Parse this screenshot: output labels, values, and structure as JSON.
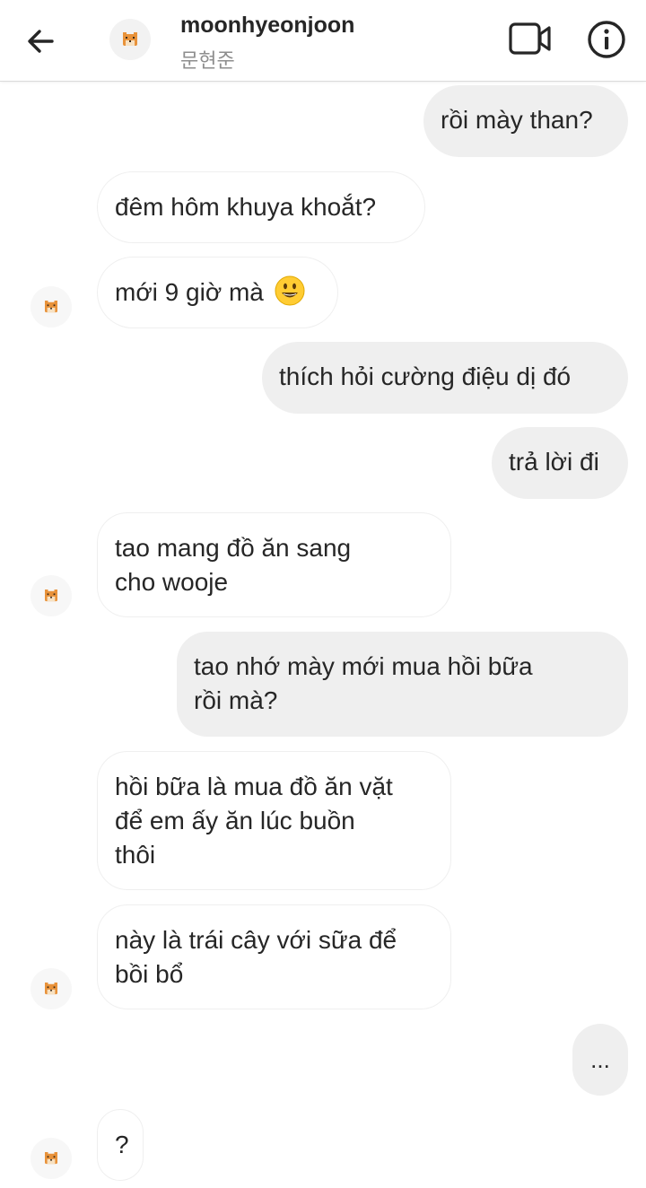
{
  "header": {
    "username": "moonhyeonjoon",
    "subname": "문현준",
    "back_icon": "arrow-left-icon",
    "video_icon": "video-camera-icon",
    "info_icon": "info-icon",
    "avatar_icon": "tiger-avatar-icon"
  },
  "messages": [
    {
      "from": "me",
      "text": "rồi mày than?"
    },
    {
      "from": "them",
      "text": "đêm hôm khuya khoắt?"
    },
    {
      "from": "them",
      "text": "mới 9 giờ mà",
      "emoji": "grinning-face-icon"
    },
    {
      "from": "me",
      "text": "thích hỏi cường điệu dị đó"
    },
    {
      "from": "me",
      "text": "trả lời đi"
    },
    {
      "from": "them",
      "lines": [
        "tao mang đồ ăn sang",
        "cho wooje"
      ]
    },
    {
      "from": "me",
      "lines": [
        "tao nhớ mày mới mua hồi bữa",
        "rồi mà?"
      ]
    },
    {
      "from": "them",
      "lines": [
        "hồi bữa là mua đồ ăn vặt",
        "để em ấy ăn lúc buồn",
        "thôi"
      ]
    },
    {
      "from": "them",
      "lines": [
        "này là trái cây với sữa để",
        "bồi bổ"
      ]
    },
    {
      "from": "me",
      "text": "..."
    },
    {
      "from": "them",
      "text": "?"
    }
  ],
  "colors": {
    "bubble_out": "#efefef",
    "bubble_in_border": "#efefef",
    "text": "#262626",
    "subtext": "#8e8e8e"
  }
}
